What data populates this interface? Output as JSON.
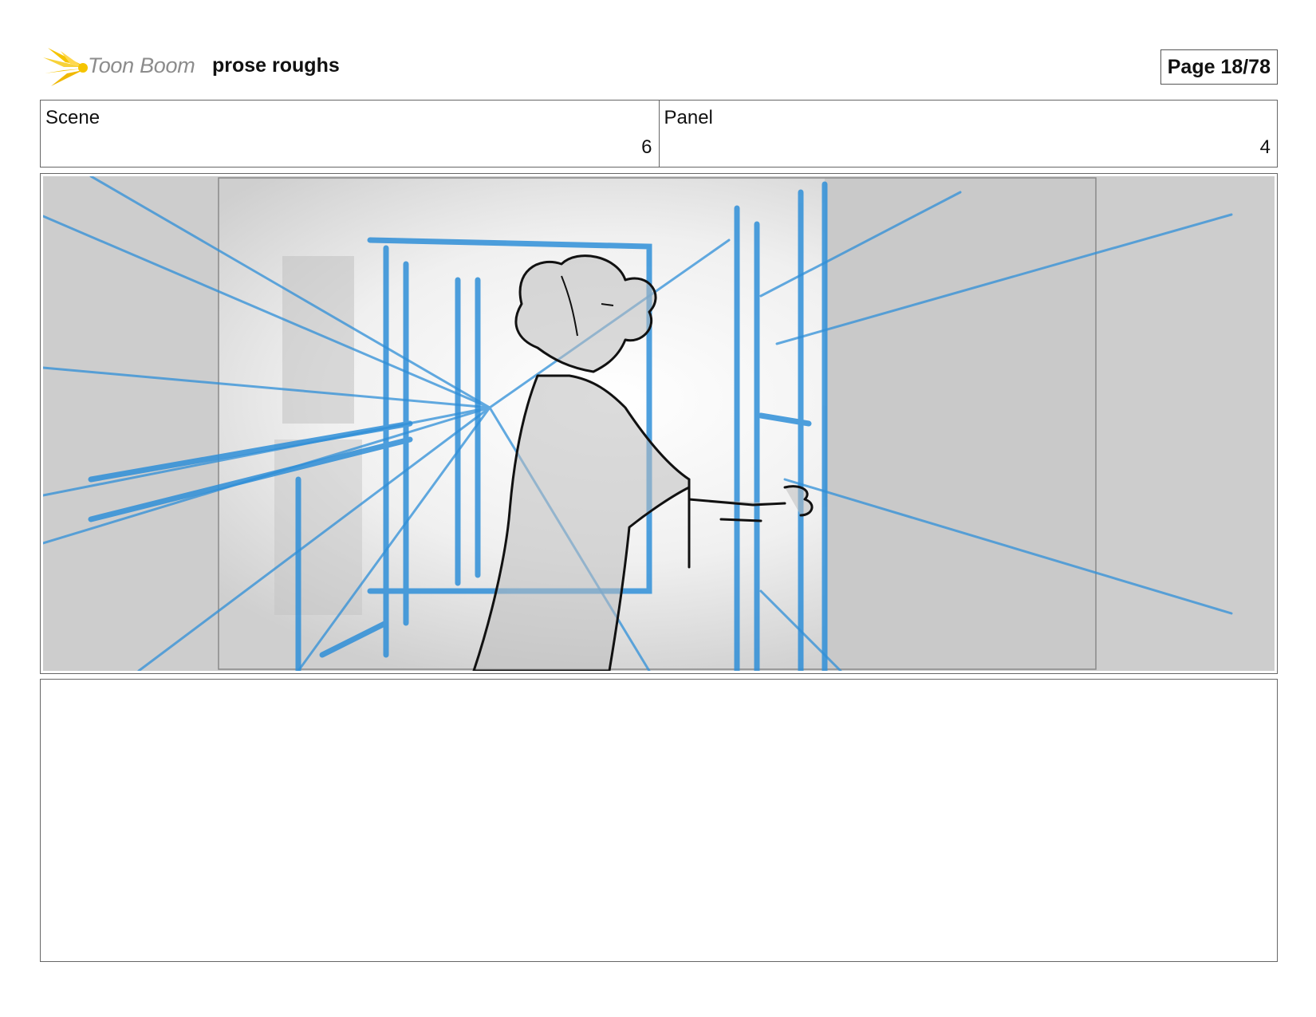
{
  "header": {
    "logo_text": "Toon Boom",
    "project_title": "prose roughs",
    "page_label": "Page 18/78"
  },
  "scene": {
    "label": "Scene",
    "value": "6"
  },
  "panel": {
    "label": "Panel",
    "value": "4"
  },
  "notes": {
    "text": ""
  },
  "colors": {
    "logo_yellow": "#f5c400",
    "sketch_blue": "#2f8fd8",
    "border": "#666666"
  },
  "icons": {
    "logo": "toon-boom-burst-icon"
  }
}
